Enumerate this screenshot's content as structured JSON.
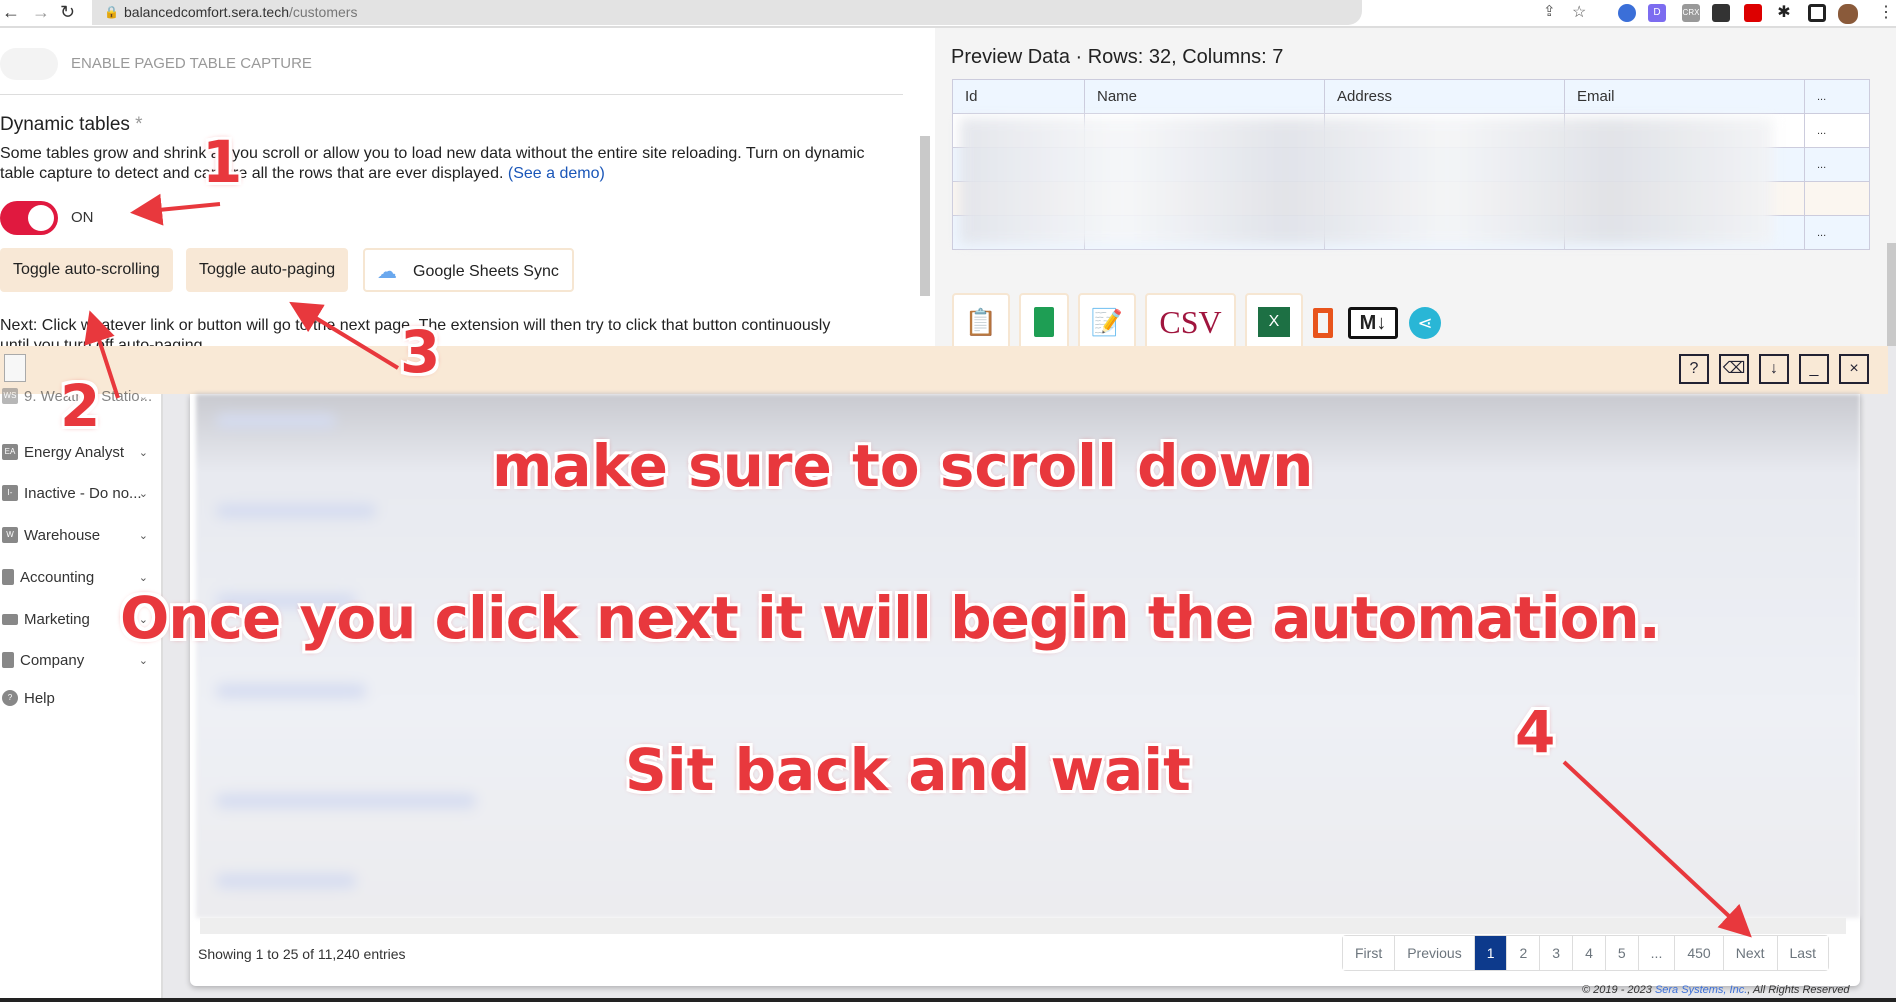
{
  "browser": {
    "url_host": "balancedcomfort.sera.tech",
    "url_path": "/customers",
    "ext_crx": "CRX"
  },
  "extension": {
    "paged_capture_label": "ENABLE PAGED TABLE CAPTURE",
    "dynamic_title": "Dynamic tables",
    "dynamic_asterisk": "*",
    "dynamic_desc": "Some tables grow and shrink as you scroll or allow you to load new data without the entire site reloading. Turn on dynamic table capture to detect and capture all the rows that are ever displayed.",
    "demo_link": "(See a demo)",
    "toggle_state": "ON",
    "toggle_on": true,
    "buttons": {
      "auto_scroll": "Toggle auto-scrolling",
      "auto_page": "Toggle auto-paging",
      "sheets": "Google Sheets Sync"
    },
    "next_text": "Next: Click whatever link or button will go to the next page. The extension will then try to click that button continuously",
    "next_text2": "until you turn off auto-paging"
  },
  "preview": {
    "title": "Preview Data",
    "meta": "· Rows: 32, Columns: 7",
    "columns": [
      "Id",
      "Name",
      "Address",
      "Email",
      "..."
    ],
    "row_more": "...",
    "export_icons": [
      "clipboard-add-icon",
      "google-sheets-icon",
      "clipboard-edit-icon",
      "csv-icon",
      "excel-icon",
      "office-icon",
      "markdown-icon",
      "share-icon"
    ],
    "csv_label": "CSV",
    "md_label": "M↓"
  },
  "controls": {
    "help": "?",
    "clear": "⌫",
    "download": "↓",
    "minimize": "_",
    "close": "×"
  },
  "sidebar": {
    "items": [
      {
        "label": "9. Weather Statio...",
        "icon": "WS"
      },
      {
        "label": "Energy Analyst",
        "icon": "EA"
      },
      {
        "label": "Inactive - Do no...",
        "icon": "I-"
      },
      {
        "label": "Warehouse",
        "icon": "W"
      },
      {
        "label": "Accounting",
        "icon": "calculator-icon"
      },
      {
        "label": "Marketing",
        "icon": "mail-icon"
      },
      {
        "label": "Company",
        "icon": "building-icon"
      }
    ],
    "help": "Help"
  },
  "table": {
    "info": "Showing 1 to 25 of 11,240 entries",
    "pagination": [
      "First",
      "Previous",
      "1",
      "2",
      "3",
      "4",
      "5",
      "...",
      "450",
      "Next",
      "Last"
    ],
    "active_page": "1"
  },
  "footer": {
    "prefix": "© 2019 - 2023 ",
    "company": "Sera Systems, Inc.",
    "suffix": ", All Rights Reserved"
  },
  "annotations": {
    "scroll": "make sure to scroll down",
    "automation": "Once you click next it will begin the automation.",
    "wait": "Sit back and wait",
    "steps": [
      "1",
      "2",
      "3",
      "4"
    ]
  },
  "colors": {
    "accent_red": "#e0193f",
    "peach": "#f8e8d6",
    "active_page": "#0d3a8c",
    "annotation": "#e8383d"
  }
}
